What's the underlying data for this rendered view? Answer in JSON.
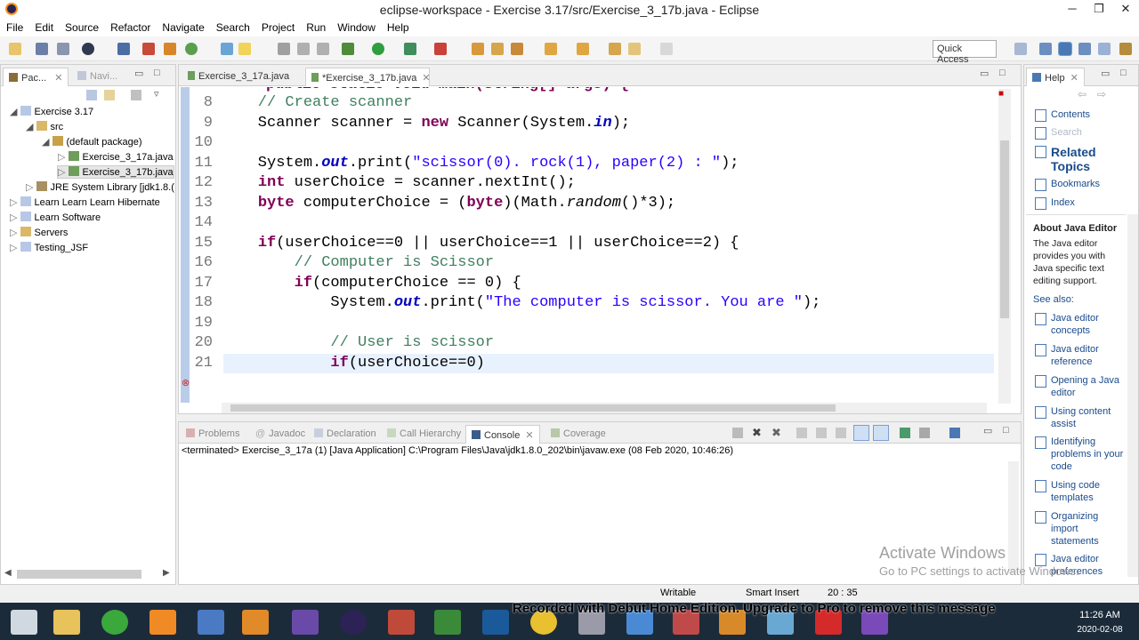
{
  "window": {
    "title": "eclipse-workspace - Exercise 3.17/src/Exercise_3_17b.java - Eclipse",
    "minimize": "─",
    "restore": "❐",
    "close": "✕"
  },
  "menu": [
    "File",
    "Edit",
    "Source",
    "Refactor",
    "Navigate",
    "Search",
    "Project",
    "Run",
    "Window",
    "Help"
  ],
  "toolbar": {
    "quick_access": "Quick Access"
  },
  "left_panel": {
    "tabs": [
      "Pac...",
      "Navi..."
    ],
    "tree": [
      {
        "label": "Exercise 3.17",
        "indent": 0
      },
      {
        "label": "src",
        "indent": 1
      },
      {
        "label": "(default package)",
        "indent": 2
      },
      {
        "label": "Exercise_3_17a.java",
        "indent": 3
      },
      {
        "label": "Exercise_3_17b.java",
        "indent": 3
      },
      {
        "label": "JRE System Library [jdk1.8.(",
        "indent": 1
      },
      {
        "label": "Learn Learn Learn Hibernate",
        "indent": 0
      },
      {
        "label": "Learn Software",
        "indent": 0
      },
      {
        "label": "Servers",
        "indent": 0
      },
      {
        "label": "Testing_JSF",
        "indent": 0
      }
    ]
  },
  "editor": {
    "tabs": [
      "Exercise_3_17a.java",
      "*Exercise_3_17b.java"
    ],
    "lines": [
      {
        "n": "8",
        "code": [
          {
            "t": "    // Create scanner",
            "c": "cm"
          }
        ]
      },
      {
        "n": "9",
        "code": [
          {
            "t": "    Scanner scanner = ",
            "c": ""
          },
          {
            "t": "new",
            "c": "kw"
          },
          {
            "t": " Scanner(System.",
            "c": ""
          },
          {
            "t": "in",
            "c": "fi"
          },
          {
            "t": ");",
            "c": ""
          }
        ]
      },
      {
        "n": "10",
        "code": []
      },
      {
        "n": "11",
        "code": [
          {
            "t": "    System.",
            "c": ""
          },
          {
            "t": "out",
            "c": "fi"
          },
          {
            "t": ".print(",
            "c": ""
          },
          {
            "t": "\"scissor(0). rock(1), paper(2) : \"",
            "c": "st"
          },
          {
            "t": ");",
            "c": ""
          }
        ]
      },
      {
        "n": "12",
        "code": [
          {
            "t": "    ",
            "c": ""
          },
          {
            "t": "int",
            "c": "kw"
          },
          {
            "t": " userChoice = scanner.nextInt();",
            "c": ""
          }
        ]
      },
      {
        "n": "13",
        "code": [
          {
            "t": "    ",
            "c": ""
          },
          {
            "t": "byte",
            "c": "kw"
          },
          {
            "t": " computerChoice = (",
            "c": ""
          },
          {
            "t": "byte",
            "c": "kw"
          },
          {
            "t": ")(Math.",
            "c": ""
          },
          {
            "t": "random",
            "c": "it"
          },
          {
            "t": "()*3);",
            "c": ""
          }
        ]
      },
      {
        "n": "14",
        "code": []
      },
      {
        "n": "15",
        "code": [
          {
            "t": "    ",
            "c": ""
          },
          {
            "t": "if",
            "c": "kw"
          },
          {
            "t": "(userChoice==0 || userChoice==1 || userChoice==2) {",
            "c": ""
          }
        ]
      },
      {
        "n": "16",
        "code": [
          {
            "t": "        // Computer is Scissor",
            "c": "cm"
          }
        ]
      },
      {
        "n": "17",
        "code": [
          {
            "t": "        ",
            "c": ""
          },
          {
            "t": "if",
            "c": "kw"
          },
          {
            "t": "(computerChoice == 0) {",
            "c": ""
          }
        ]
      },
      {
        "n": "18",
        "code": [
          {
            "t": "            System.",
            "c": ""
          },
          {
            "t": "out",
            "c": "fi"
          },
          {
            "t": ".print(",
            "c": ""
          },
          {
            "t": "\"The computer is scissor. You are \"",
            "c": "st"
          },
          {
            "t": ");",
            "c": ""
          }
        ]
      },
      {
        "n": "19",
        "code": []
      },
      {
        "n": "20",
        "code": [
          {
            "t": "            // User is scissor",
            "c": "cm"
          }
        ]
      },
      {
        "n": "21",
        "code": [
          {
            "t": "            ",
            "c": ""
          },
          {
            "t": "if",
            "c": "kw"
          },
          {
            "t": "(userChoice==0)",
            "c": ""
          }
        ]
      }
    ]
  },
  "bottom_panel": {
    "tabs": [
      "Problems",
      "Javadoc",
      "Declaration",
      "Call Hierarchy",
      "Console",
      "Coverage"
    ],
    "console_header": "<terminated> Exercise_3_17a (1) [Java Application] C:\\Program Files\\Java\\jdk1.8.0_202\\bin\\javaw.exe (08 Feb 2020, 10:46:26)"
  },
  "help_panel": {
    "tab": "Help",
    "links": [
      "Contents",
      "Search",
      "Related Topics",
      "Bookmarks",
      "Index"
    ],
    "about_title": "About Java Editor",
    "about_text": "The Java editor provides you with Java specific text editing support.",
    "see_also": "See also:",
    "see_links": [
      "Java editor concepts",
      "Java editor reference",
      "Opening a Java editor",
      "Using content assist",
      "Identifying problems in your code",
      "Using code templates",
      "Organizing import statements",
      "Java editor preferences"
    ]
  },
  "status": {
    "writable": "Writable",
    "insert": "Smart Insert",
    "position": "20 : 35"
  },
  "watermark": {
    "line1": "Activate Windows",
    "line2": "Go to PC settings to activate Windows."
  },
  "recorded": "Recorded with Debut Home Edition. Upgrade to Pro to remove this message",
  "clock": {
    "time": "11:26 AM",
    "date": "2020-02-08"
  },
  "colors": {
    "keyword": "#7f0055",
    "comment": "#3f7f5f",
    "string": "#2a00ff",
    "field": "#0000c0",
    "link": "#1a4b8c"
  }
}
